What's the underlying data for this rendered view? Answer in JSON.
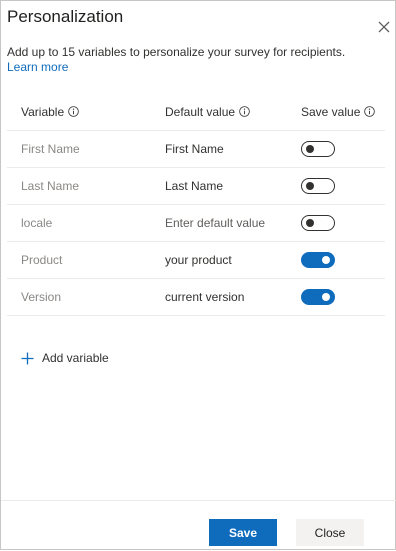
{
  "dialog": {
    "title": "Personalization",
    "description": "Add up to 15 variables to personalize your survey for recipients.",
    "learn_more": "Learn more"
  },
  "table": {
    "headers": {
      "variable": "Variable",
      "default_value": "Default value",
      "save_value": "Save value"
    },
    "rows": [
      {
        "name": "First Name",
        "default": "First Name",
        "placeholder": false,
        "save": false
      },
      {
        "name": "Last Name",
        "default": "Last Name",
        "placeholder": false,
        "save": false
      },
      {
        "name": "locale",
        "default": "Enter default value",
        "placeholder": true,
        "save": false
      },
      {
        "name": "Product",
        "default": "your product",
        "placeholder": false,
        "save": true
      },
      {
        "name": "Version",
        "default": "current version",
        "placeholder": false,
        "save": true
      }
    ]
  },
  "add_variable": {
    "label": "Add variable"
  },
  "footer": {
    "save_label": "Save",
    "close_label": "Close"
  },
  "colors": {
    "accent": "#0f6cbd",
    "toggle_off_border": "#323130"
  },
  "icons": [
    "close-icon",
    "info-icon",
    "plus-icon"
  ]
}
